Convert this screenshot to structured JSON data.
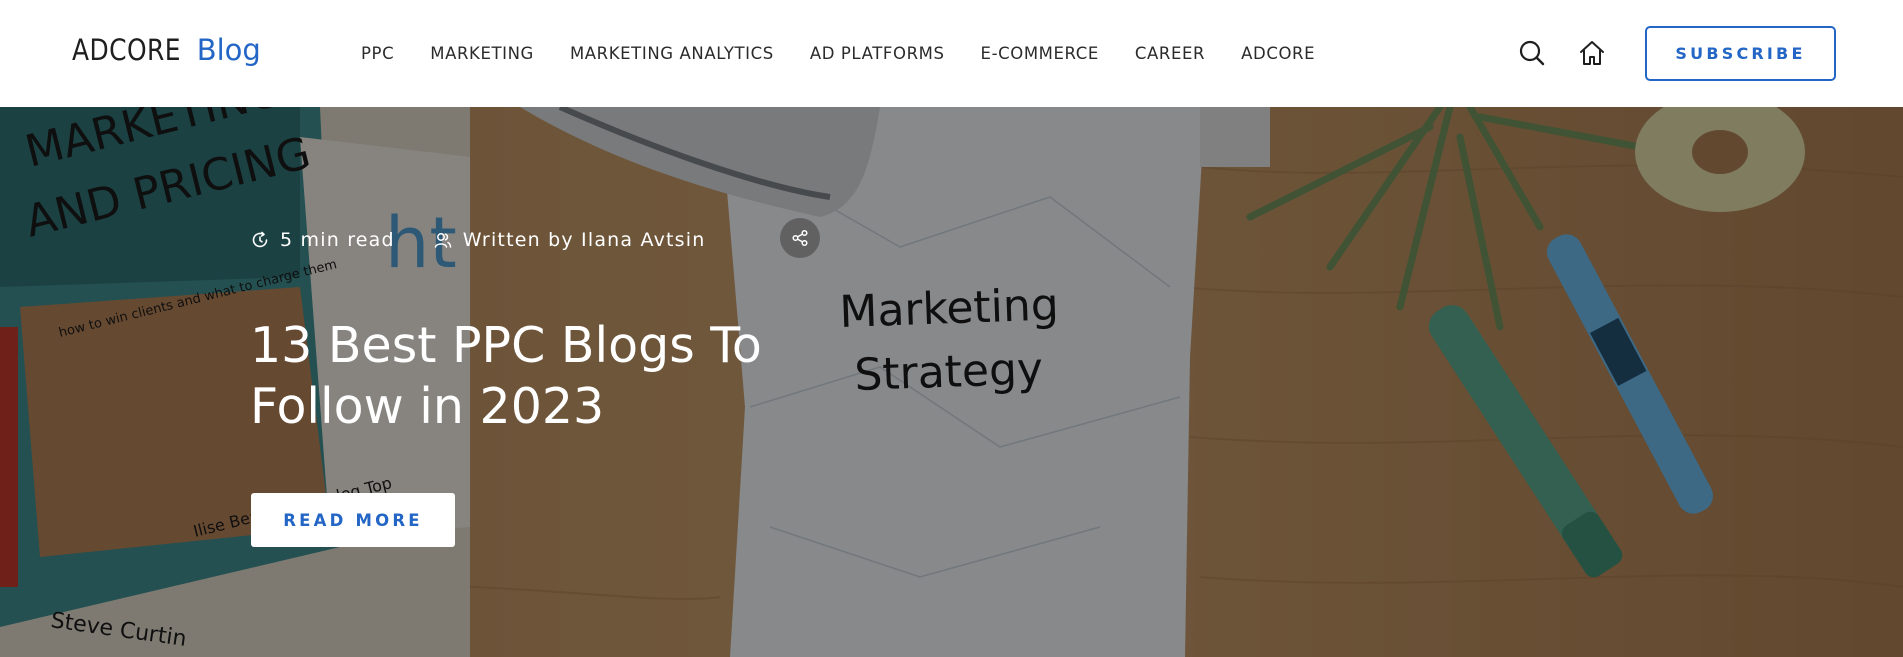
{
  "header": {
    "logo": {
      "main": "ADCORE",
      "sub": "Blog"
    },
    "nav": [
      {
        "label": "PPC"
      },
      {
        "label": "MARKETING"
      },
      {
        "label": "MARKETING ANALYTICS"
      },
      {
        "label": "AD PLATFORMS"
      },
      {
        "label": "E-COMMERCE"
      },
      {
        "label": "CAREER"
      },
      {
        "label": "ADCORE"
      }
    ],
    "icons": {
      "search": "search-icon",
      "home": "home-icon"
    },
    "subscribe_label": "SUBSCRIBE"
  },
  "hero": {
    "read_time": "5 min read",
    "author": "Written by Ilana Avtsin",
    "title_lines": [
      "13 Best PPC Blogs To",
      "Follow in 2023"
    ],
    "read_more_label": "READ MORE",
    "image_text": {
      "book_title": "MARKETING AND PRICING",
      "book_tagline": "how to win clients and what to charge them",
      "book_authors": "Ilise Benun and Peleg Top",
      "book_author_2": "Steve Curtin",
      "paper_note": [
        "Marketing",
        "Strategy"
      ]
    }
  },
  "colors": {
    "brand_blue": "#2366c5",
    "header_bg": "#ffffff",
    "text_dark": "#2b2b2b",
    "hero_text": "#ffffff"
  }
}
